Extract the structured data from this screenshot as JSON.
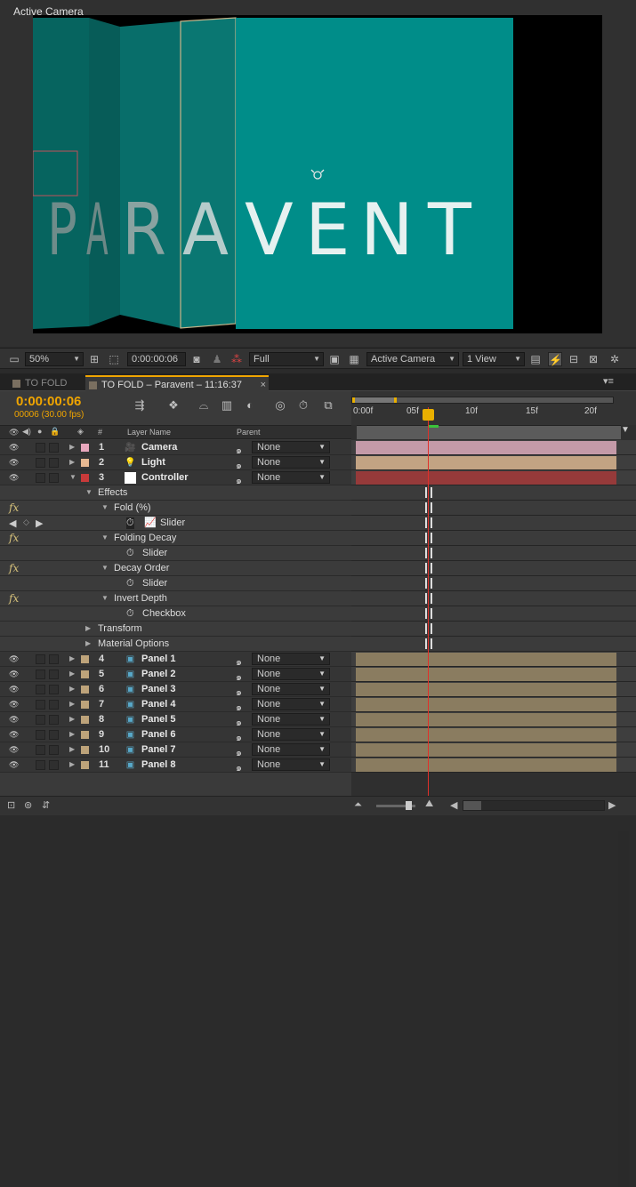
{
  "viewer": {
    "title": "Active Camera",
    "artwork_text": [
      "P",
      "A",
      "R",
      "A",
      "V",
      "E",
      "N",
      "T"
    ]
  },
  "viewer_toolbar": {
    "zoom": "50%",
    "timecode": "0:00:00:06",
    "resolution": "Full",
    "view": "Active Camera",
    "layout": "1 View"
  },
  "tabs": [
    {
      "label": "TO FOLD",
      "active": false
    },
    {
      "label": "TO FOLD – Paravent – 11:16:37",
      "active": true
    }
  ],
  "timeline": {
    "timecode": "0:00:00:06",
    "frames": "00006 (30.00 fps)",
    "columns": {
      "num": "#",
      "layer_name": "Layer Name",
      "parent": "Parent"
    },
    "ruler_ticks": [
      {
        "label": "0:00f"
      },
      {
        "label": "05f"
      },
      {
        "label": "10f"
      },
      {
        "label": "15f"
      },
      {
        "label": "20f"
      }
    ],
    "rows": [
      {
        "kind": "layer",
        "num": "1",
        "name": "Camera",
        "icon": "camera-icon",
        "label_color": "#e8a7bd",
        "parent": "None",
        "bar_color": "#c49aa8"
      },
      {
        "kind": "layer",
        "num": "2",
        "name": "Light",
        "icon": "lightbulb-icon",
        "label_color": "#e7b993",
        "parent": "None",
        "bar_color": "#c2a383"
      },
      {
        "kind": "layer",
        "num": "3",
        "name": "Controller",
        "icon": "solid-icon",
        "label_color": "#c83a3a",
        "parent": "None",
        "bar_color": "#963a3a"
      },
      {
        "kind": "group",
        "level": 1,
        "name": "Effects"
      },
      {
        "kind": "effect",
        "level": 2,
        "name": "Fold (%)"
      },
      {
        "kind": "param",
        "level": 3,
        "name": "Slider",
        "keyframes": true
      },
      {
        "kind": "effect",
        "level": 2,
        "name": "Folding Decay"
      },
      {
        "kind": "param",
        "level": 3,
        "name": "Slider"
      },
      {
        "kind": "effect",
        "level": 2,
        "name": "Decay Order"
      },
      {
        "kind": "param",
        "level": 3,
        "name": "Slider"
      },
      {
        "kind": "effect",
        "level": 2,
        "name": "Invert Depth"
      },
      {
        "kind": "param",
        "level": 3,
        "name": "Checkbox"
      },
      {
        "kind": "group",
        "level": 1,
        "name": "Transform",
        "collapsed": true
      },
      {
        "kind": "group",
        "level": 1,
        "name": "Material Options",
        "collapsed": true
      },
      {
        "kind": "layer",
        "num": "4",
        "name": "Panel 1",
        "icon": "precomp-icon",
        "label_color": "#bda37a",
        "parent": "None",
        "bar_color": "#8a7c60"
      },
      {
        "kind": "layer",
        "num": "5",
        "name": "Panel 2",
        "icon": "precomp-icon",
        "label_color": "#bda37a",
        "parent": "None",
        "bar_color": "#8a7c60"
      },
      {
        "kind": "layer",
        "num": "6",
        "name": "Panel 3",
        "icon": "precomp-icon",
        "label_color": "#bda37a",
        "parent": "None",
        "bar_color": "#8a7c60"
      },
      {
        "kind": "layer",
        "num": "7",
        "name": "Panel 4",
        "icon": "precomp-icon",
        "label_color": "#bda37a",
        "parent": "None",
        "bar_color": "#8a7c60"
      },
      {
        "kind": "layer",
        "num": "8",
        "name": "Panel 5",
        "icon": "precomp-icon",
        "label_color": "#bda37a",
        "parent": "None",
        "bar_color": "#8a7c60"
      },
      {
        "kind": "layer",
        "num": "9",
        "name": "Panel 6",
        "icon": "precomp-icon",
        "label_color": "#bda37a",
        "parent": "None",
        "bar_color": "#8a7c60"
      },
      {
        "kind": "layer",
        "num": "10",
        "name": "Panel 7",
        "icon": "precomp-icon",
        "label_color": "#bda37a",
        "parent": "None",
        "bar_color": "#8a7c60"
      },
      {
        "kind": "layer",
        "num": "11",
        "name": "Panel 8",
        "icon": "precomp-icon",
        "label_color": "#bda37a",
        "parent": "None",
        "bar_color": "#8a7c60"
      }
    ]
  },
  "colors": {
    "accent_timecode": "#f0a500",
    "playhead": "#e0302a",
    "teal": "#008e8a"
  }
}
